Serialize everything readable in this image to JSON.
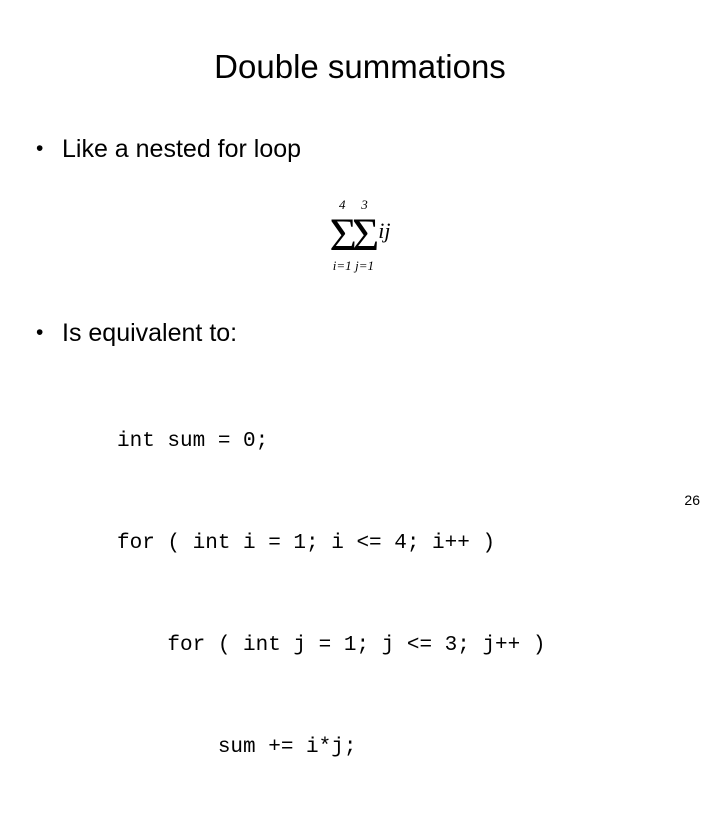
{
  "slide": {
    "title": "Double summations",
    "page_number": "26",
    "background_color": "#ffffff",
    "text_color": "#000000"
  },
  "bullets": [
    {
      "marker": "•",
      "text": "Like a nested for loop"
    },
    {
      "marker": "•",
      "text": "Is equivalent to:"
    }
  ],
  "formula": {
    "description": "double summation of i times j",
    "outer": {
      "sigma": "Σ",
      "upper_limit": "4",
      "lower_limit": "i=1"
    },
    "inner": {
      "sigma": "Σ",
      "upper_limit": "3",
      "lower_limit": "j=1"
    },
    "operand": "ij"
  },
  "code": {
    "lines": [
      "int sum = 0;",
      "for ( int i = 1; i <= 4; i++ )",
      "    for ( int j = 1; j <= 3; j++ )",
      "        sum += i*j;"
    ]
  }
}
